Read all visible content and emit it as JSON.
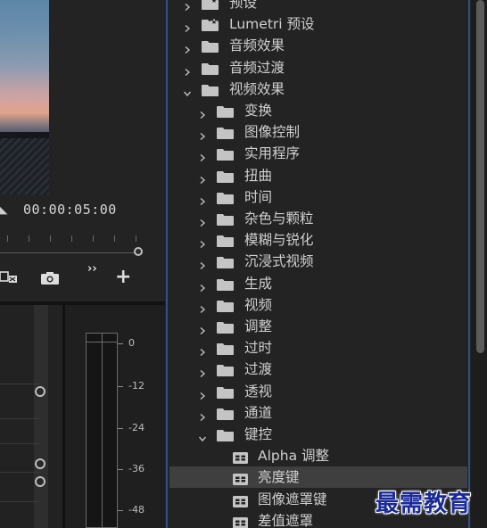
{
  "program_monitor": {
    "timecode": "00:00:05:00",
    "playhead_position": 1.0
  },
  "audio_meter": {
    "db_labels": [
      "0",
      "-12",
      "-24",
      "-36",
      "-48"
    ]
  },
  "effects_panel": {
    "items": [
      {
        "label": "预设",
        "level": 0,
        "expanded": false,
        "icon": "preset-folder-icon"
      },
      {
        "label": "Lumetri 预设",
        "level": 0,
        "expanded": false,
        "icon": "preset-folder-icon"
      },
      {
        "label": "音频效果",
        "level": 0,
        "expanded": false,
        "icon": "folder-icon"
      },
      {
        "label": "音频过渡",
        "level": 0,
        "expanded": false,
        "icon": "folder-icon"
      },
      {
        "label": "视频效果",
        "level": 0,
        "expanded": true,
        "icon": "folder-icon"
      },
      {
        "label": "变换",
        "level": 1,
        "expanded": false,
        "icon": "folder-icon"
      },
      {
        "label": "图像控制",
        "level": 1,
        "expanded": false,
        "icon": "folder-icon"
      },
      {
        "label": "实用程序",
        "level": 1,
        "expanded": false,
        "icon": "folder-icon"
      },
      {
        "label": "扭曲",
        "level": 1,
        "expanded": false,
        "icon": "folder-icon"
      },
      {
        "label": "时间",
        "level": 1,
        "expanded": false,
        "icon": "folder-icon"
      },
      {
        "label": "杂色与颗粒",
        "level": 1,
        "expanded": false,
        "icon": "folder-icon"
      },
      {
        "label": "模糊与锐化",
        "level": 1,
        "expanded": false,
        "icon": "folder-icon"
      },
      {
        "label": "沉浸式视频",
        "level": 1,
        "expanded": false,
        "icon": "folder-icon"
      },
      {
        "label": "生成",
        "level": 1,
        "expanded": false,
        "icon": "folder-icon"
      },
      {
        "label": "视频",
        "level": 1,
        "expanded": false,
        "icon": "folder-icon"
      },
      {
        "label": "调整",
        "level": 1,
        "expanded": false,
        "icon": "folder-icon"
      },
      {
        "label": "过时",
        "level": 1,
        "expanded": false,
        "icon": "folder-icon"
      },
      {
        "label": "过渡",
        "level": 1,
        "expanded": false,
        "icon": "folder-icon"
      },
      {
        "label": "透视",
        "level": 1,
        "expanded": false,
        "icon": "folder-icon"
      },
      {
        "label": "通道",
        "level": 1,
        "expanded": false,
        "icon": "folder-icon"
      },
      {
        "label": "键控",
        "level": 1,
        "expanded": true,
        "icon": "folder-icon"
      },
      {
        "label": "Alpha 调整",
        "level": 2,
        "icon": "effect-preset-icon"
      },
      {
        "label": "亮度键",
        "level": 2,
        "icon": "effect-preset-icon",
        "selected": true
      },
      {
        "label": "图像遮罩键",
        "level": 2,
        "icon": "effect-preset-icon"
      },
      {
        "label": "差值遮罩",
        "level": 2,
        "icon": "effect-preset-icon"
      }
    ]
  },
  "watermark": "最需教育",
  "colors": {
    "panel_bg": "#232323",
    "selected_row": "#3f3f3f",
    "panel_border_accent": "#2d4f8a",
    "watermark": "#1a2a9a"
  }
}
